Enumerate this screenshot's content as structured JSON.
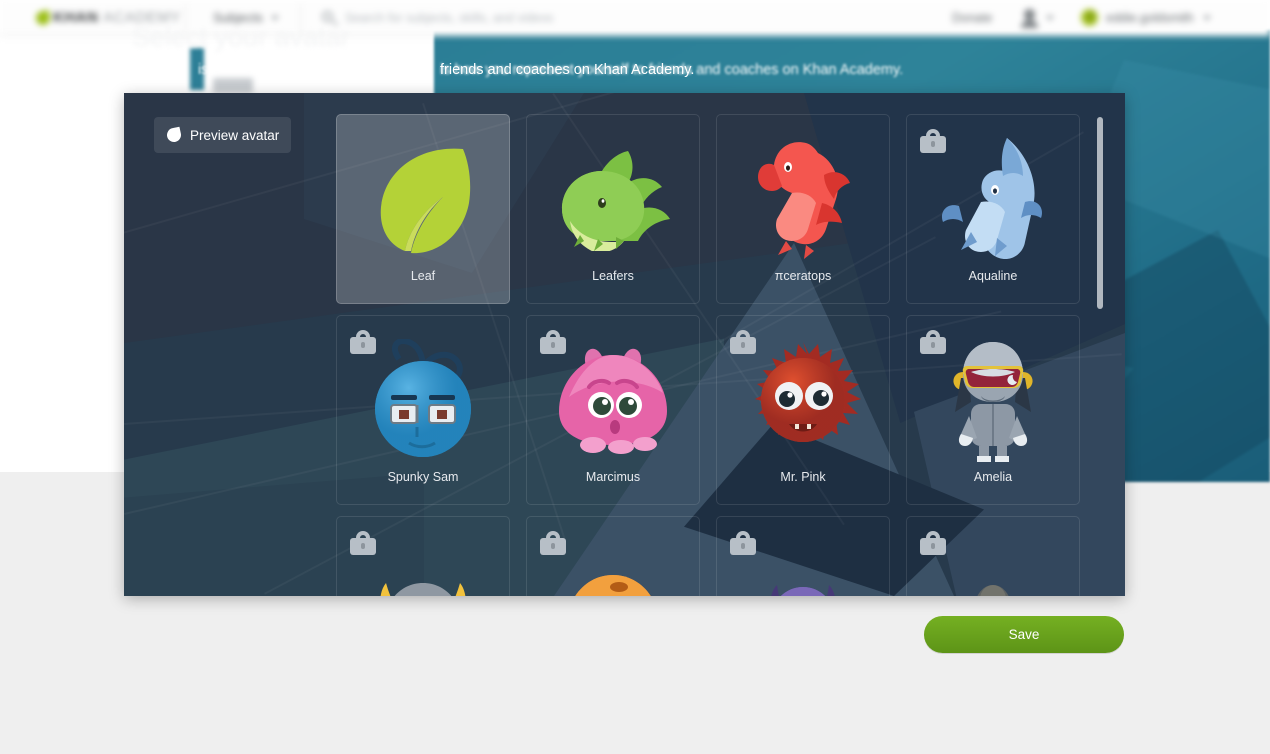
{
  "nav": {
    "logo_bold": "KHAN",
    "logo_light": "ACADEMY",
    "logo_icon": "leaf-logo-icon",
    "subjects_label": "Subjects",
    "search_placeholder": "Search for subjects, skills, and videos",
    "search_icon": "search-icon",
    "donate_label": "Donate",
    "account_icon": "person-icon",
    "username": "eddie.goldsmith",
    "caret_icon": "chevron-down-icon"
  },
  "page": {
    "heading": "Select your avatar",
    "subtext_lead": "is how you represent yourself to",
    "subtext_tail": "friends and coaches on Khan Academy.",
    "hero_text": "is how you represent yourself to friends and coaches on Khan Academy."
  },
  "modal": {
    "preview_button": {
      "label": "Preview avatar",
      "icon": "leaf-icon"
    },
    "lock_icon": "lock-icon",
    "scrollbar": "vertical-scrollbar",
    "avatars": [
      {
        "name": "Leaf",
        "art": "leaf",
        "locked": false,
        "selected": true
      },
      {
        "name": "Leafers",
        "art": "leafers",
        "locked": false,
        "selected": false
      },
      {
        "name": "πceratops",
        "art": "piceratops",
        "locked": false,
        "selected": false
      },
      {
        "name": "Aqualine",
        "art": "aqualine",
        "locked": true,
        "selected": false
      },
      {
        "name": "Spunky Sam",
        "art": "spunky-sam",
        "locked": true,
        "selected": false
      },
      {
        "name": "Marcimus",
        "art": "marcimus",
        "locked": true,
        "selected": false
      },
      {
        "name": "Mr. Pink",
        "art": "mr-pink",
        "locked": true,
        "selected": false
      },
      {
        "name": "Amelia",
        "art": "amelia",
        "locked": true,
        "selected": false
      },
      {
        "name": "",
        "art": "orange-horns",
        "locked": true,
        "selected": false
      },
      {
        "name": "",
        "art": "orange-dome",
        "locked": true,
        "selected": false
      },
      {
        "name": "",
        "art": "purple-horns",
        "locked": true,
        "selected": false
      },
      {
        "name": "",
        "art": "grey-blank",
        "locked": true,
        "selected": false
      }
    ]
  },
  "footer": {
    "save_label": "Save"
  },
  "colors": {
    "modal_bg": "#273a4c",
    "save_green": "#66a11c",
    "teal_panel": "#2b7e96",
    "page_grey": "#efefef",
    "lock_grey": "#b7bfc7",
    "leaf_green": "#a9c523"
  }
}
